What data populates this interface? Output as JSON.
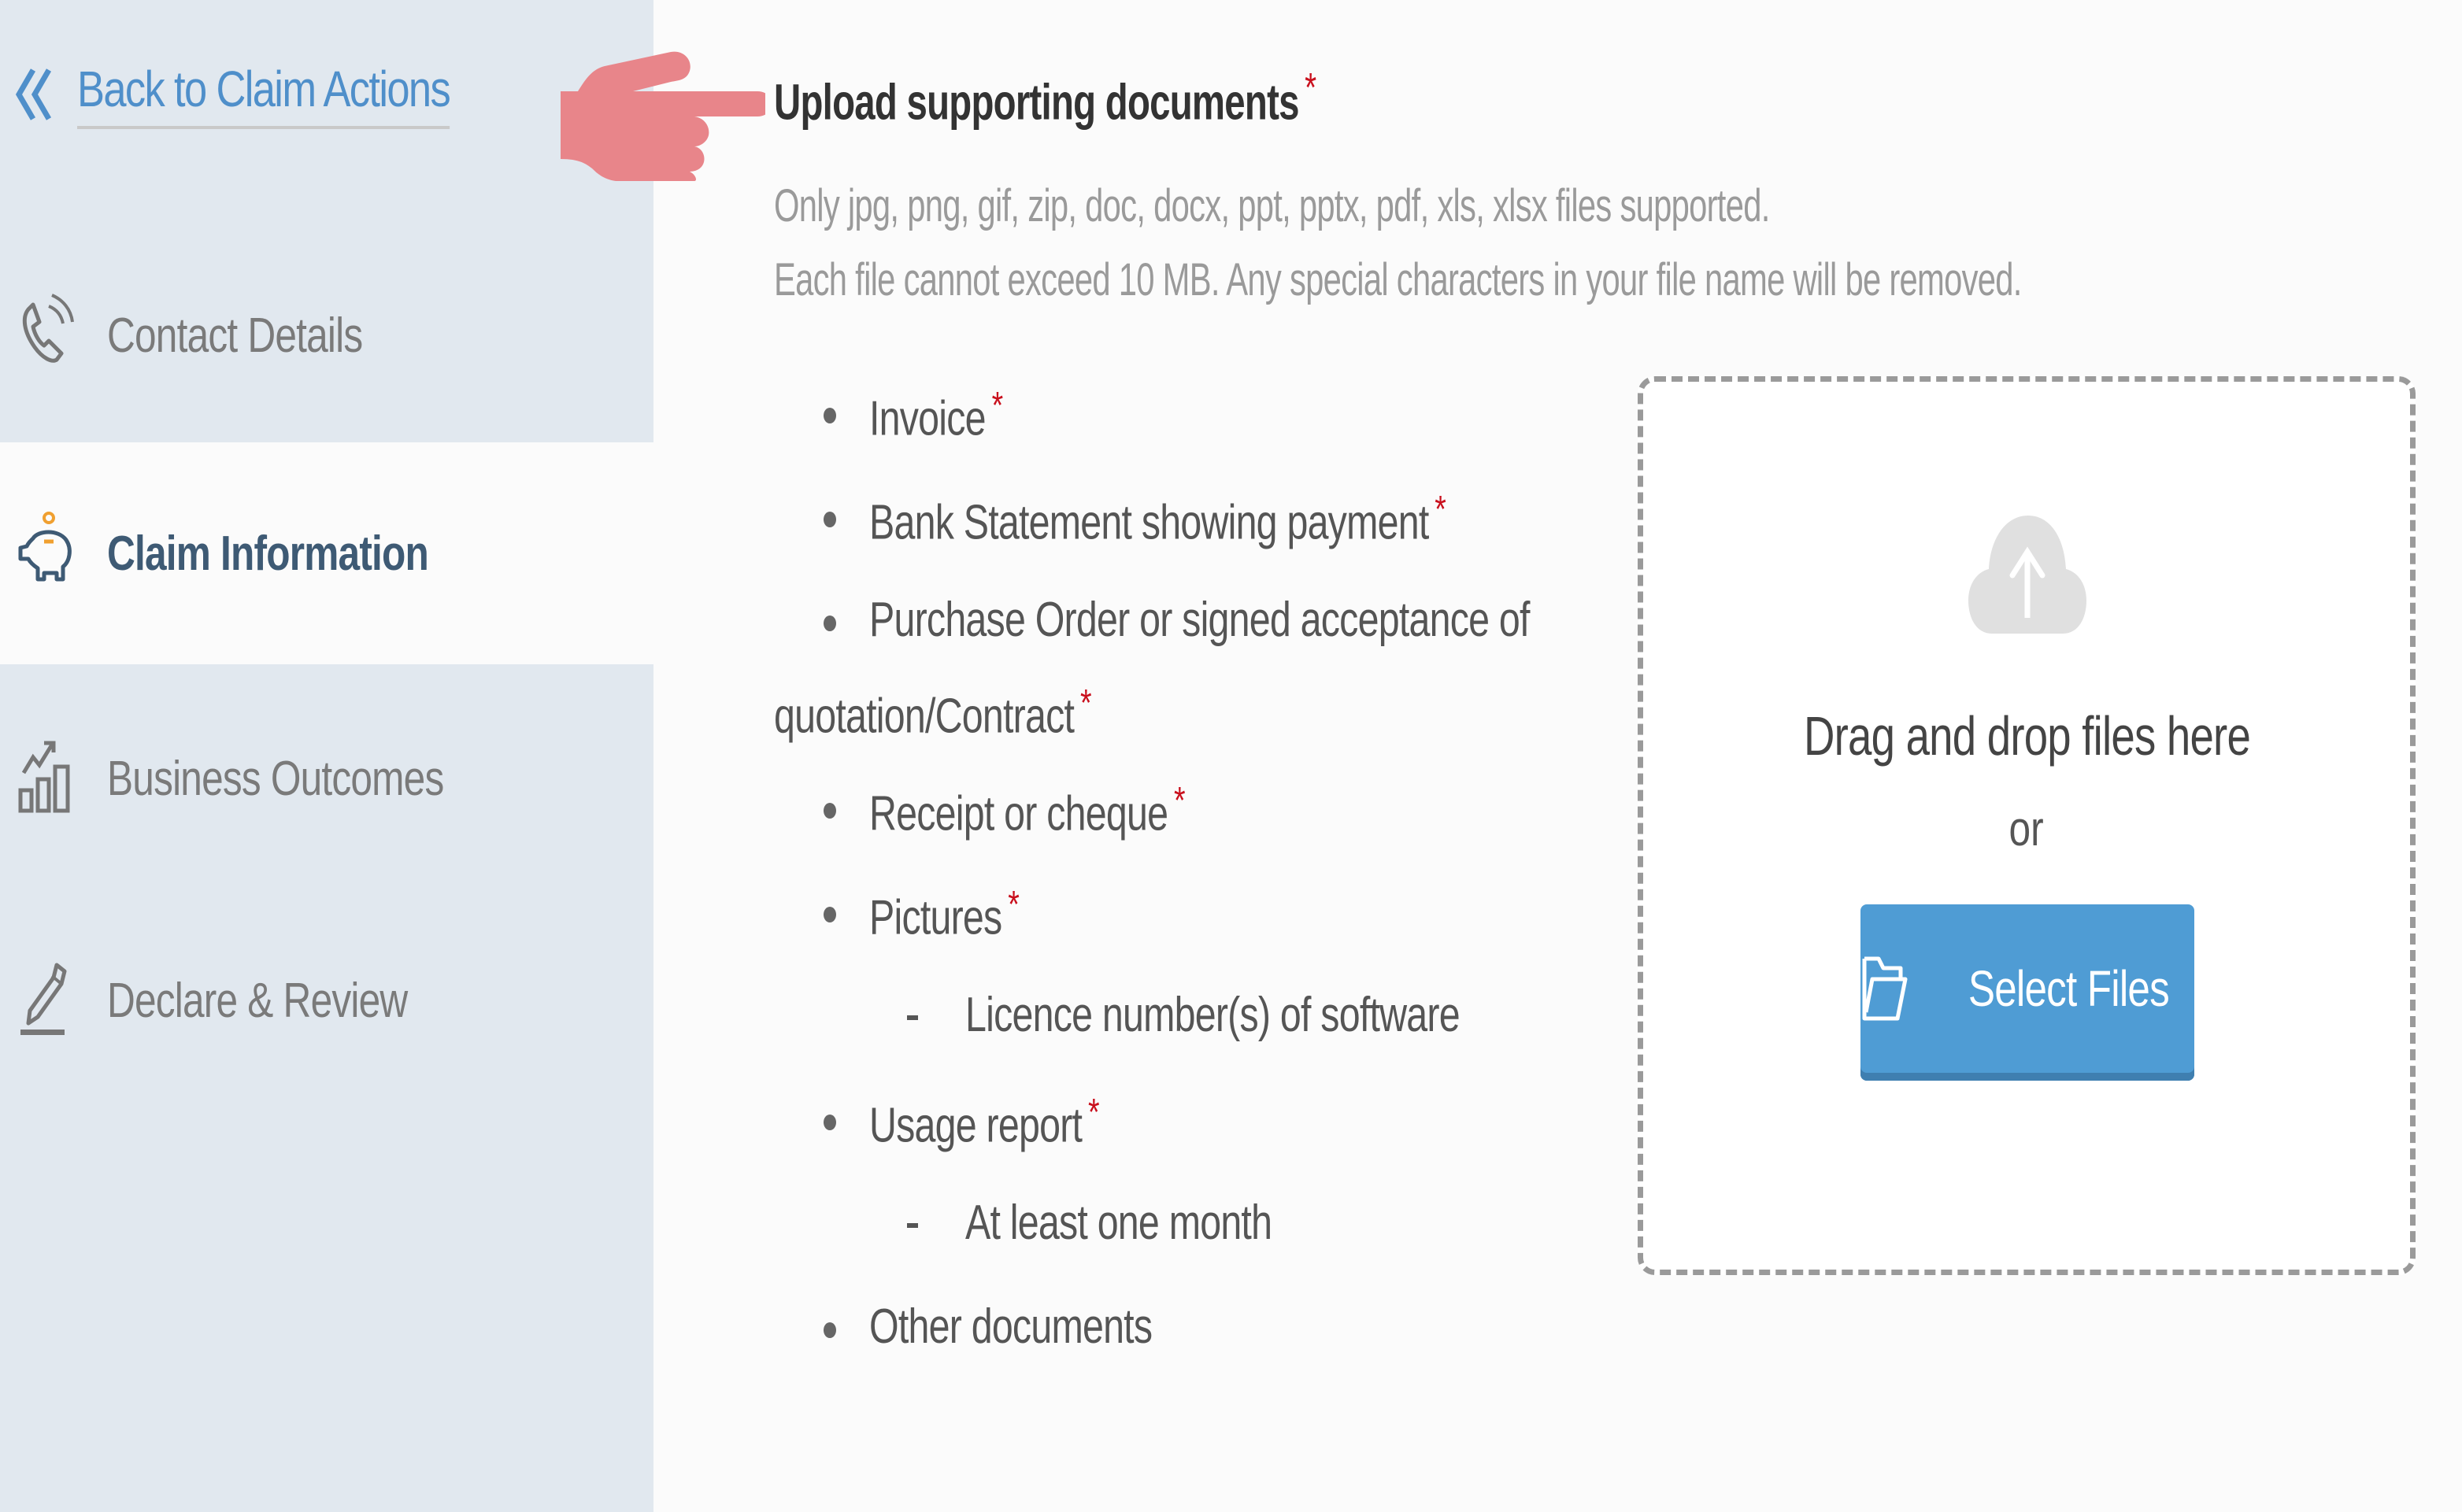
{
  "sidebar": {
    "back_link": {
      "label": "Back to Claim Actions",
      "icon": "double-chevron-left-icon"
    },
    "items": [
      {
        "label": "Contact Details",
        "icon": "phone-icon",
        "active": false
      },
      {
        "label": "Claim Information",
        "icon": "piggy-bank-icon",
        "active": true
      },
      {
        "label": "Business Outcomes",
        "icon": "bar-chart-growth-icon",
        "active": false
      },
      {
        "label": "Declare & Review",
        "icon": "pen-signature-icon",
        "active": false
      }
    ]
  },
  "annotation": {
    "icon": "pointing-hand-icon",
    "color": "#e8858a"
  },
  "upload": {
    "heading": "Upload supporting documents",
    "required_marker": "*",
    "help_lines": [
      "Only jpg, png, gif, zip, doc, docx, ppt, pptx, pdf, xls, xlsx files supported.",
      "Each file cannot exceed 10 MB. Any special characters in your file name will be removed."
    ],
    "documents": [
      {
        "label": "Invoice",
        "required": true
      },
      {
        "label": "Bank Statement showing payment",
        "required": true
      },
      {
        "label": "Purchase Order or signed acceptance of",
        "continuation": "quotation/Contract",
        "required": true
      },
      {
        "label": "Receipt or cheque",
        "required": true
      },
      {
        "label": "Pictures",
        "required": true,
        "sub": "Licence number(s) of software"
      },
      {
        "label": "Usage report",
        "required": true,
        "sub": "At least one month"
      },
      {
        "label": "Other documents",
        "required": false
      }
    ],
    "dropzone": {
      "icon": "cloud-upload-icon",
      "title": "Drag and drop files here",
      "or": "or",
      "button_label": "Select Files",
      "button_icon": "folder-open-icon"
    }
  },
  "colors": {
    "sidebar_bg": "#e1e8ef",
    "link_blue": "#4f8fca",
    "active_text": "#3e5a74",
    "accent_orange": "#f0a030",
    "required_red": "#c9101d",
    "button_blue": "#4f9cd4"
  }
}
